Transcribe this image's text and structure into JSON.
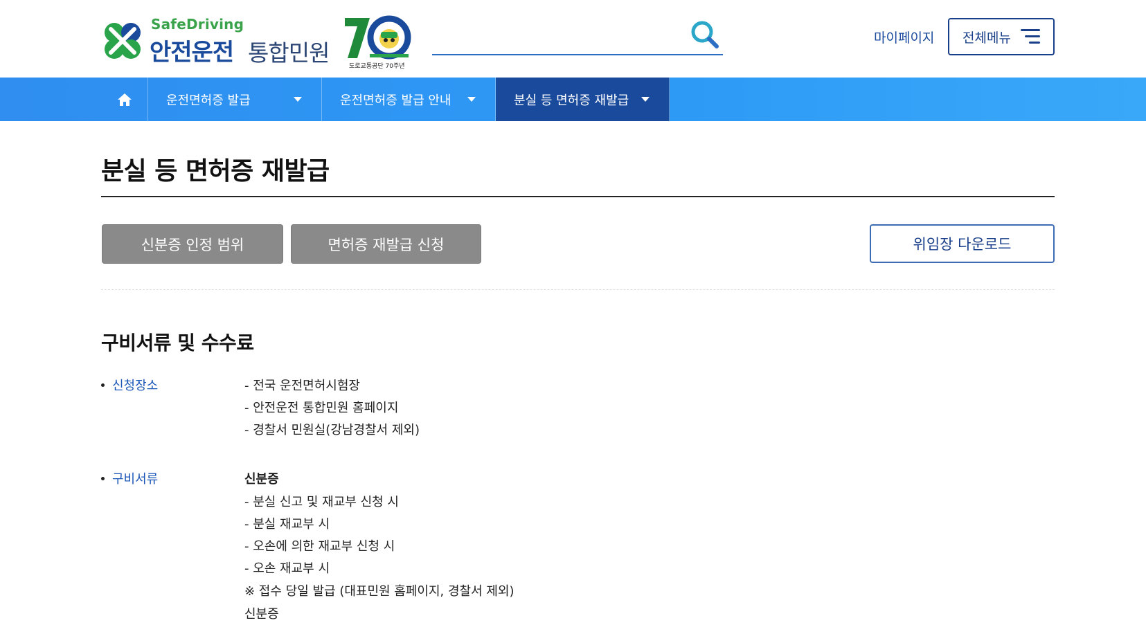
{
  "header": {
    "logo": {
      "brand_en": "SafeDriving",
      "brand_ko_main": "안전운전",
      "brand_ko_sub": "통합민원",
      "anniversary_caption": "도로교통공단 70주년"
    },
    "search": {
      "placeholder": ""
    },
    "mypage_label": "마이페이지",
    "allmenu_label": "전체메뉴"
  },
  "nav": {
    "items": [
      {
        "label": "운전면허증 발급"
      },
      {
        "label": "운전면허증 발급 안내"
      },
      {
        "label": "분실 등 면허증 재발급"
      }
    ]
  },
  "main": {
    "page_title": "분실 등 면허증 재발급",
    "tabs": [
      {
        "label": "신분증 인정 범위"
      },
      {
        "label": "면허증 재발급 신청"
      }
    ],
    "download_label": "위임장 다운로드",
    "section_title": "구비서류 및 수수료",
    "rows": [
      {
        "label": "신청장소",
        "items": [
          "- 전국 운전면허시험장",
          "- 안전운전 통합민원 홈페이지",
          "- 경찰서 민원실(강남경찰서 제외)"
        ]
      },
      {
        "label": "구비서류",
        "heading": "신분증",
        "items": [
          "- 분실 신고 및 재교부 신청 시",
          "- 분실 재교부 시",
          "- 오손에 의한 재교부 신청 시",
          "- 오손 재교부 시",
          "※ 접수 당일 발급 (대표민원 홈페이지, 경찰서 제외)",
          "신분증"
        ]
      }
    ]
  },
  "colors": {
    "nav_blue": "#2f8ef0",
    "nav_active": "#1a4a9c",
    "brand_green": "#3aa24a",
    "brand_navy": "#1a4a9c",
    "label_blue": "#1a56b8",
    "tab_gray": "#8a8a8a"
  },
  "icons": [
    "clover-logo-icon",
    "seventy-anniversary-emblem-icon",
    "search-icon",
    "hamburger-icon",
    "home-icon",
    "caret-down-icon"
  ]
}
